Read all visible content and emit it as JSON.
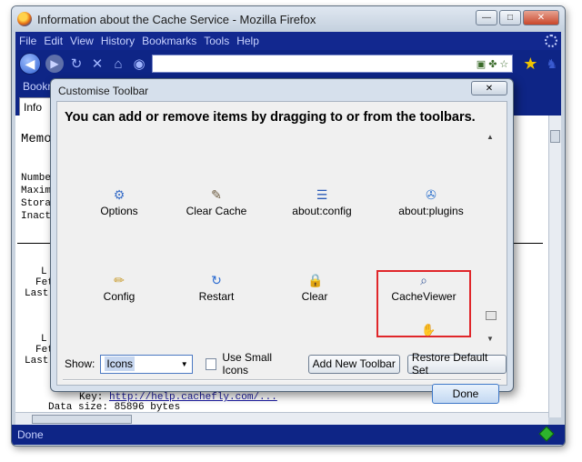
{
  "window": {
    "title": "Information about the Cache Service - Mozilla Firefox",
    "minimize_label": "—",
    "maximize_label": "□",
    "close_label": "✕"
  },
  "menu": [
    "File",
    "Edit",
    "View",
    "History",
    "Bookmarks",
    "Tools",
    "Help"
  ],
  "bookmarks_label": "Bookm...Toolbar Items",
  "tab_label": "Info",
  "content": {
    "heading": "Memo",
    "labels": [
      "Numbe",
      "Maxim",
      "Stora",
      "Inact"
    ],
    "rows": [
      {
        "a": "L",
        "b": "Fet",
        "c": "Last"
      },
      {
        "a": "L",
        "b": "Fet",
        "c": "Last"
      }
    ],
    "key_label": "Key:",
    "key_link": "http://help.cachefly.com/...",
    "data_size_label": "Data size:",
    "data_size_value": "85896 bytes"
  },
  "status": "Done",
  "dialog": {
    "title": "Customise Toolbar",
    "close_label": "✕",
    "heading": "You can add or remove items by dragging to or from the toolbars.",
    "items": [
      {
        "label": "Options",
        "icon": "options-gears-icon"
      },
      {
        "label": "Clear Cache",
        "icon": "clear-cache-icon"
      },
      {
        "label": "about:config",
        "icon": "about-config-icon"
      },
      {
        "label": "about:plugins",
        "icon": "about-plugins-icon"
      },
      {
        "label": "Config",
        "icon": "config-icon"
      },
      {
        "label": "Restart",
        "icon": "restart-icon"
      },
      {
        "label": "Clear",
        "icon": "lock-icon"
      },
      {
        "label": "CacheViewer",
        "icon": "cacheviewer-icon"
      }
    ],
    "show_label": "Show:",
    "show_value": "Icons",
    "small_icons_label": "Use Small Icons",
    "add_toolbar_label": "Add New Toolbar",
    "restore_label": "Restore Default Set",
    "done_label": "Done"
  },
  "colors": {
    "toolbar_blue": "#0e2586",
    "highlight_red": "#e0262a"
  }
}
